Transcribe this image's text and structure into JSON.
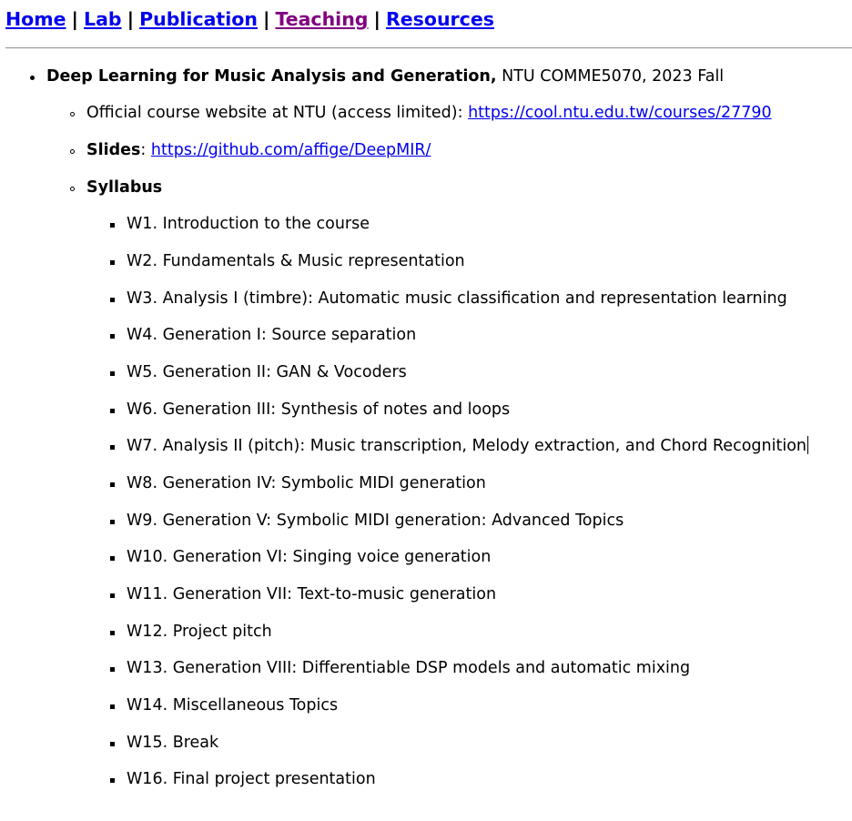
{
  "nav": {
    "items": [
      {
        "label": "Home"
      },
      {
        "label": "Lab"
      },
      {
        "label": "Publication"
      },
      {
        "label": "Teaching"
      },
      {
        "label": "Resources"
      }
    ],
    "separator": "|"
  },
  "course": {
    "title": "Deep Learning for Music Analysis and Generation",
    "comma": ",",
    "code_term": " NTU COMME5070, 2023 Fall"
  },
  "website": {
    "text": "Official course website at NTU (access limited): ",
    "url": "https://cool.ntu.edu.tw/courses/27790"
  },
  "slides": {
    "label": "Slides",
    "colon": ": ",
    "url": "https://github.com/affige/DeepMIR/"
  },
  "syllabus": {
    "label": "Syllabus",
    "weeks": [
      "W1. Introduction to the course",
      "W2. Fundamentals & Music representation",
      "W3. Analysis I (timbre): Automatic music classification and representation learning",
      "W4. Generation I: Source separation",
      "W5. Generation II: GAN & Vocoders",
      "W6. Generation III: Synthesis of notes and loops",
      "W7. Analysis II (pitch): Music transcription, Melody extraction, and Chord Recognition",
      "W8. Generation IV: Symbolic MIDI generation",
      "W9. Generation V: Symbolic MIDI generation: Advanced Topics",
      "W10. Generation VI: Singing voice generation",
      "W11. Generation VII: Text-to-music generation",
      "W12. Project pitch",
      "W13. Generation VIII: Differentiable DSP models and automatic mixing",
      "W14. Miscellaneous Topics",
      "W15. Break",
      "W16. Final project presentation"
    ]
  },
  "colors": {
    "link": "#0000ee",
    "visited": "#800080",
    "text": "#000000"
  }
}
